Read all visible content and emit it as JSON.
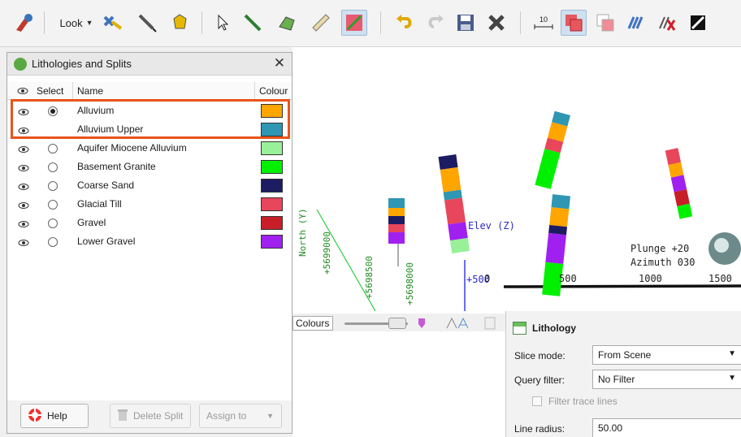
{
  "toolbar": {
    "look_label": "Look",
    "ten_label": "10"
  },
  "panel": {
    "title": "Lithologies and Splits",
    "columns": {
      "select": "Select",
      "name": "Name",
      "colour": "Colour"
    },
    "items": [
      {
        "name": "Alluvium",
        "colour": "#ffa500",
        "selected": true,
        "radio": true
      },
      {
        "name": "Alluvium Upper",
        "colour": "#2f96b4",
        "selected": false,
        "radio": false
      },
      {
        "name": "Aquifer Miocene Alluvium",
        "colour": "#98f098",
        "selected": false,
        "radio": true
      },
      {
        "name": "Basement Granite",
        "colour": "#00f000",
        "selected": false,
        "radio": true
      },
      {
        "name": "Coarse Sand",
        "colour": "#1c1c63",
        "selected": false,
        "radio": true
      },
      {
        "name": "Glacial Till",
        "colour": "#e8465a",
        "selected": false,
        "radio": true
      },
      {
        "name": "Gravel",
        "colour": "#c81e28",
        "selected": false,
        "radio": true
      },
      {
        "name": "Lower Gravel",
        "colour": "#a020f0",
        "selected": false,
        "radio": true
      }
    ],
    "buttons": {
      "help": "Help",
      "delete_split": "Delete Split",
      "assign_to": "Assign to"
    }
  },
  "scene": {
    "north_label": "North (Y)",
    "northing_labels": [
      "+5699000",
      "+5698500",
      "+5698000"
    ],
    "elev_label": "Elev (Z)",
    "elev_value": "+500",
    "plunge": "Plunge +20",
    "azimuth": "Azimuth 030",
    "scale_labels": [
      "0",
      "500",
      "1000",
      "1500"
    ]
  },
  "colours_bar": {
    "label": "Colours"
  },
  "properties": {
    "title": "Lithology",
    "slice_mode_label": "Slice mode:",
    "slice_mode_value": "From Scene",
    "query_filter_label": "Query filter:",
    "query_filter_value": "No Filter",
    "filter_trace_label": "Filter trace lines",
    "line_radius_label": "Line radius:",
    "line_radius_value": "50.00"
  }
}
